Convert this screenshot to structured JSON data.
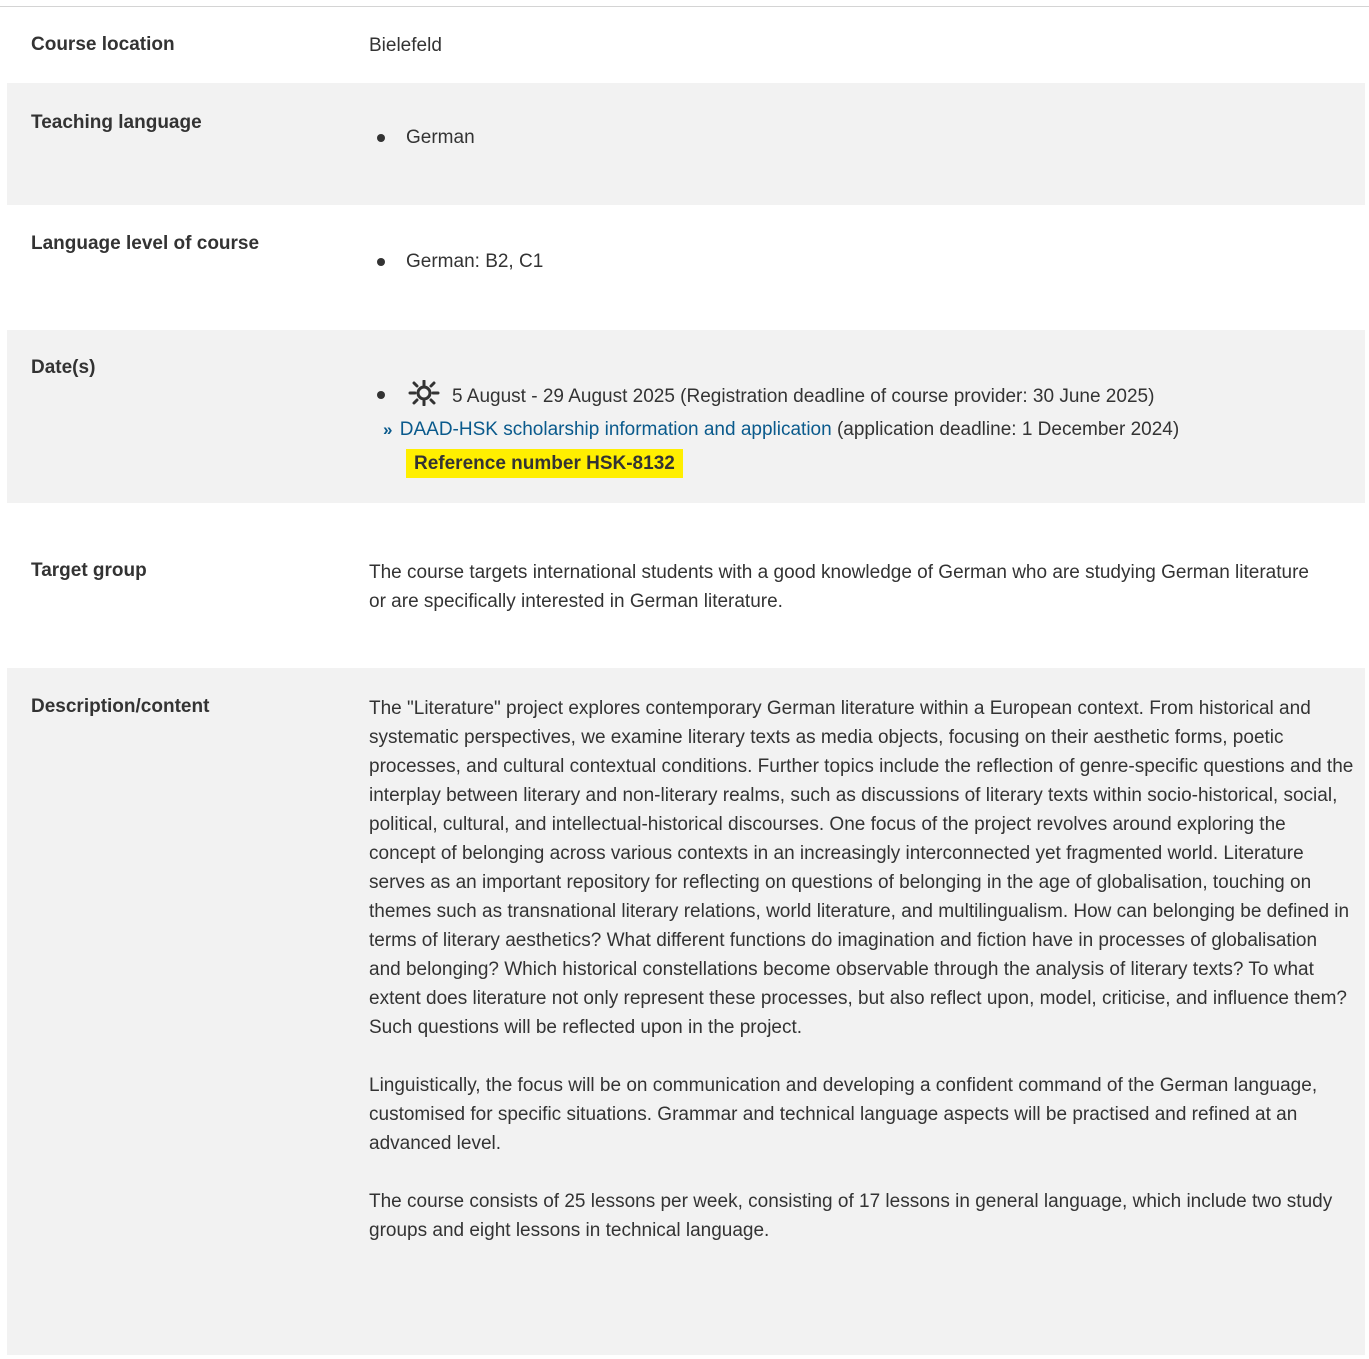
{
  "rows": {
    "location": {
      "label": "Course location",
      "value": "Bielefeld"
    },
    "teaching_language": {
      "label": "Teaching language",
      "items": [
        "German"
      ]
    },
    "language_level": {
      "label": "Language level of course",
      "items": [
        "German: B2, C1"
      ]
    },
    "dates": {
      "label": "Date(s)",
      "icon": "sun-icon",
      "date_text": "5 August - 29 August 2025 (Registration deadline of course provider: 30 June 2025)",
      "link_marker": "»",
      "link_text": "DAAD-HSK scholarship information and application",
      "link_suffix": "(application deadline: 1 December 2024)",
      "reference": "Reference number HSK-8132"
    },
    "target_group": {
      "label": "Target group",
      "value": "The course targets international students with a good knowledge of German who are studying German literature or are specifically interested in German literature."
    },
    "description": {
      "label": "Description/content",
      "paragraphs": [
        "The \"Literature\" project explores contemporary German literature within a European context. From historical and systematic perspectives, we examine literary texts as media objects, focusing on their aesthetic forms, poetic processes, and cultural contextual conditions. Further topics include the reflection of genre-specific questions and the interplay between literary and non-literary realms, such as discussions of literary texts within socio-historical, social, political, cultural, and intellectual-historical discourses. One focus of the project revolves around exploring the concept of belonging across various contexts in an increasingly interconnected yet fragmented world. Literature serves as an important repository for reflecting on questions of belonging in the age of globalisation, touching on themes such as transnational literary relations, world literature, and multilingualism. How can belonging be defined in terms of literary aesthetics? What different functions do imagination and fiction have in processes of globalisation and belonging? Which historical constellations become observable through the analysis of literary texts? To what extent does literature not only represent these processes, but also reflect upon, model, criticise, and influence them? Such questions will be reflected upon in the project.",
        "Linguistically, the focus will be on communication and developing a confident command of the German language, customised for specific situations. Grammar and technical language aspects will be practised and refined at an advanced level.",
        "The course consists of 25 lessons per week, consisting of 17 lessons in general language, which include two study groups and eight lessons in technical language."
      ]
    }
  },
  "colors": {
    "row_alt": "#f2f2f2",
    "link": "#0a5a8c",
    "highlight": "#ffef00",
    "text": "#333333"
  }
}
